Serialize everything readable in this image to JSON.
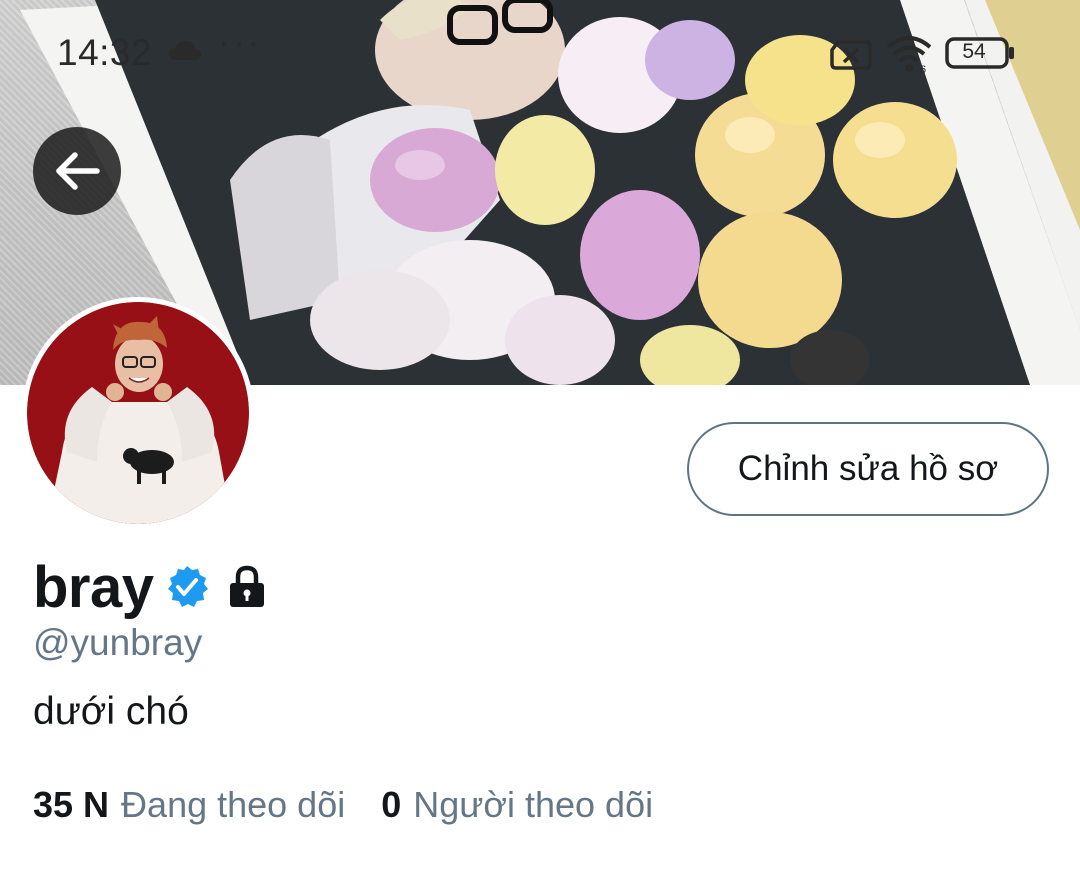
{
  "status_bar": {
    "time": "14:32",
    "dots": "···",
    "battery": "54",
    "icons": [
      "cloud-icon",
      "no-sim-icon",
      "wifi-icon",
      "battery-icon"
    ]
  },
  "header": {
    "back_icon": "arrow-left-icon"
  },
  "profile": {
    "name": "bray",
    "handle": "@yunbray",
    "bio": "dưới chó",
    "verified": true,
    "protected": true,
    "edit_button_label": "Chỉnh sửa hồ sơ",
    "following_count": "35 N",
    "following_label": "Đang theo dõi",
    "followers_count": "0",
    "followers_label": "Người theo dõi"
  },
  "colors": {
    "verified_blue": "#1d9bf0",
    "text_primary": "#14171a",
    "text_secondary": "#657786",
    "button_border": "#5f7482"
  }
}
